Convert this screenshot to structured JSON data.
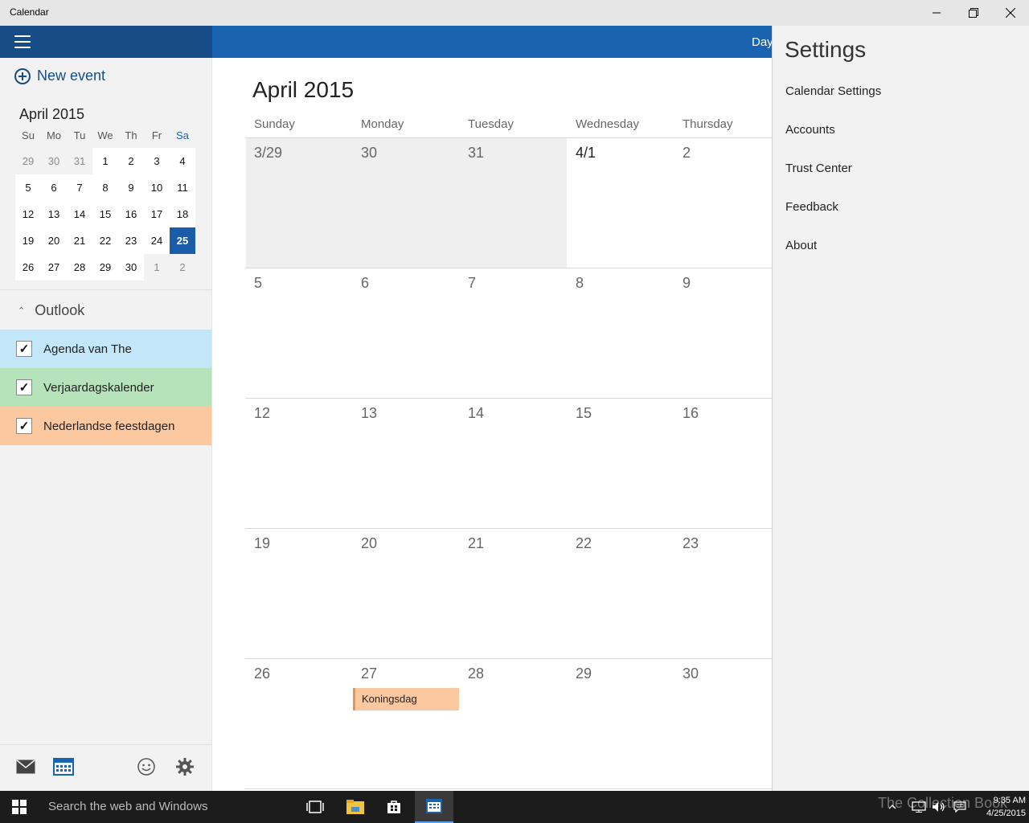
{
  "window": {
    "title": "Calendar"
  },
  "sidebar": {
    "new_event_label": "New event",
    "mini_calendar": {
      "title": "April 2015",
      "weekdays": [
        "Su",
        "Mo",
        "Tu",
        "We",
        "Th",
        "Fr",
        "Sa"
      ],
      "weeks": [
        [
          "29",
          "30",
          "31",
          "1",
          "2",
          "3",
          "4"
        ],
        [
          "5",
          "6",
          "7",
          "8",
          "9",
          "10",
          "11"
        ],
        [
          "12",
          "13",
          "14",
          "15",
          "16",
          "17",
          "18"
        ],
        [
          "19",
          "20",
          "21",
          "22",
          "23",
          "24",
          "25"
        ],
        [
          "26",
          "27",
          "28",
          "29",
          "30",
          "1",
          "2"
        ]
      ],
      "today": "25"
    },
    "account_label": "Outlook",
    "calendars": [
      {
        "label": "Agenda van The",
        "checked": true,
        "color": "#c3e7f9"
      },
      {
        "label": "Verjaardagskalender",
        "checked": true,
        "color": "#b6e3b9"
      },
      {
        "label": "Nederlandse feestdagen",
        "checked": true,
        "color": "#fcc8a0"
      }
    ]
  },
  "appbar": {
    "view_label": "Day"
  },
  "month_view": {
    "title": "April 2015",
    "weekdays": [
      "Sunday",
      "Monday",
      "Tuesday",
      "Wednesday",
      "Thursday"
    ],
    "weeks": [
      [
        "3/29",
        "30",
        "31",
        "4/1",
        "2"
      ],
      [
        "5",
        "6",
        "7",
        "8",
        "9"
      ],
      [
        "12",
        "13",
        "14",
        "15",
        "16"
      ],
      [
        "19",
        "20",
        "21",
        "22",
        "23"
      ],
      [
        "26",
        "27",
        "28",
        "29",
        "30"
      ]
    ],
    "event": {
      "label": "Koningsdag",
      "color": "#fcc8a0"
    }
  },
  "settings": {
    "title": "Settings",
    "items": [
      "Calendar Settings",
      "Accounts",
      "Trust Center",
      "Feedback",
      "About"
    ]
  },
  "taskbar": {
    "search_placeholder": "Search the web and Windows",
    "time": "9:35 AM",
    "date": "4/25/2015",
    "watermark": "The Collection Book"
  }
}
